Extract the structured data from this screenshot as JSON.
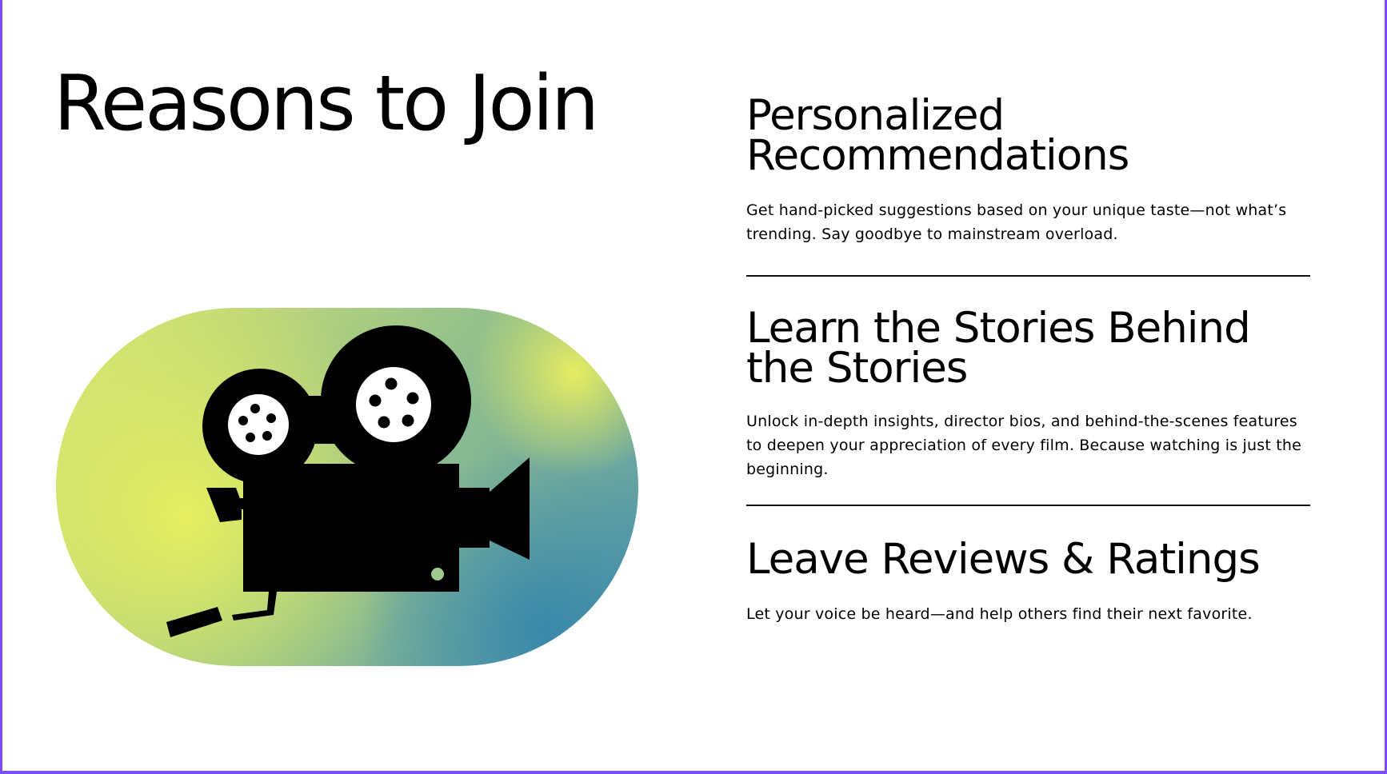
{
  "page": {
    "title": "Reasons to Join",
    "accent_color": "#7c4dff"
  },
  "hero": {
    "icon": "movie-camera-icon",
    "gradient_colors": [
      "#e8ef5e",
      "#a6cb85",
      "#4f96ae"
    ]
  },
  "features": [
    {
      "title": "Personalized Recommendations",
      "description": "Get hand-picked suggestions based on your unique taste—not what’s trending. Say goodbye to mainstream overload."
    },
    {
      "title": "Learn the Stories Behind the Stories",
      "description": "Unlock in-depth insights, director bios, and behind-the-scenes features to deepen your appreciation of every film. Because watching is just the beginning."
    },
    {
      "title": "Leave Reviews & Ratings",
      "description": "Let your voice be heard—and help others find their next favorite."
    }
  ]
}
